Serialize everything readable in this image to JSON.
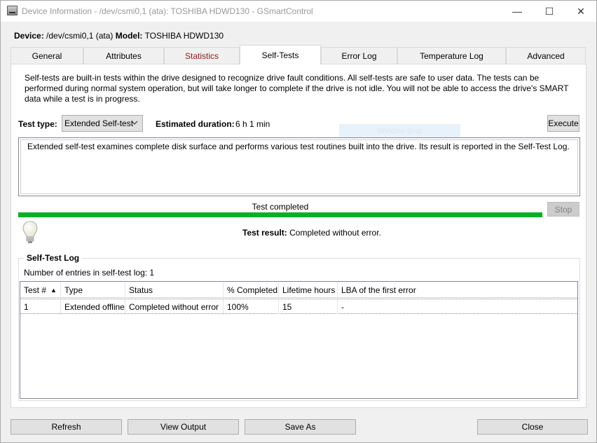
{
  "window": {
    "title": "Device Information - /dev/csmi0,1 (ata): TOSHIBA HDWD130 - GSmartControl",
    "controls": {
      "minimize": "—",
      "maximize": "☐",
      "close": "✕"
    }
  },
  "device": {
    "device_label": "Device:",
    "device_value": "/dev/csmi0,1 (ata)",
    "model_label": "Model:",
    "model_value": "TOSHIBA HDWD130"
  },
  "tabs": [
    {
      "label": "General"
    },
    {
      "label": "Attributes"
    },
    {
      "label": "Statistics"
    },
    {
      "label": "Self-Tests"
    },
    {
      "label": "Error Log"
    },
    {
      "label": "Temperature Log"
    },
    {
      "label": "Advanced"
    }
  ],
  "selftests": {
    "description": "Self-tests are built-in tests within the drive designed to recognize drive fault conditions. All self-tests are safe to user data. The tests can be performed during normal system operation, but will take longer to complete if the drive is not idle. You will not be able to access the drive's SMART data while a test is in progress.",
    "test_type_label": "Test type:",
    "test_type_value": "Extended Self-test",
    "estimated_label": "Estimated duration:",
    "estimated_value": "6 h 1 min",
    "execute_label": "Execute",
    "overlay_text": "Window Snip",
    "test_description": "Extended self-test examines complete disk surface and performs various test routines built into the drive. Its result is reported in the Self-Test Log.",
    "progress_label": "Test completed",
    "progress_percent": 100,
    "stop_label": "Stop",
    "result_label": "Test result:",
    "result_value": "Completed without error."
  },
  "log": {
    "title": "Self-Test Log",
    "count_text": "Number of entries in self-test log: 1",
    "columns": [
      "Test #",
      "Type",
      "Status",
      "% Completed",
      "Lifetime hours",
      "LBA of the first error"
    ],
    "rows": [
      [
        "1",
        "Extended offline",
        "Completed without error",
        "100%",
        "15",
        "-"
      ]
    ]
  },
  "buttons": {
    "refresh": "Refresh",
    "view_output": "View Output",
    "save_as": "Save As",
    "close": "Close"
  },
  "colors": {
    "progress_fill": "#06b025",
    "statistics_tab_text": "#8b1a1a"
  }
}
